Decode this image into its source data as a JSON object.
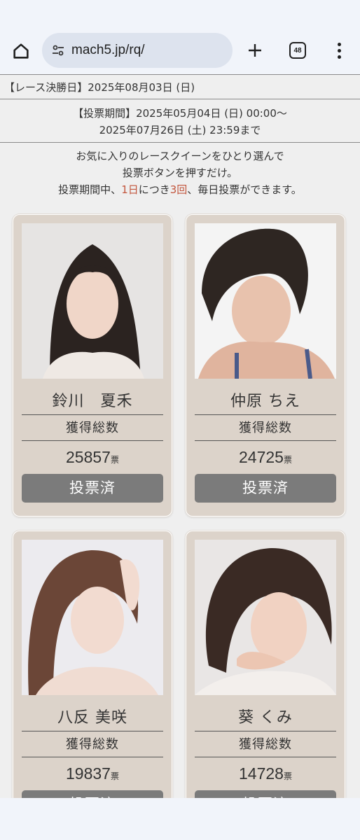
{
  "browser": {
    "url": "mach5.jp/rq/",
    "tab_count": "48"
  },
  "race_date": "【レース決勝日】2025年08月03日 (日)",
  "vote_period": {
    "line1": "【投票期間】2025年05月04日 (日) 00:00～",
    "line2": "2025年07月26日 (土) 23:59まで"
  },
  "intro": {
    "line1": "お気に入りのレースクイーンをひとり選んで",
    "line2": "投票ボタンを押すだけ。",
    "line3_pre": "投票期間中、",
    "line3_hl1": "1日",
    "line3_mid": "につき",
    "line3_hl2": "3回",
    "line3_post": "、毎日投票ができます。"
  },
  "votes_label": "獲得総数",
  "vote_unit": "票",
  "candidates": [
    {
      "name": "鈴川　夏禾",
      "votes": "25857",
      "button": "投票済"
    },
    {
      "name": "仲原 ちえ",
      "votes": "24725",
      "button": "投票済"
    },
    {
      "name": "八反 美咲",
      "votes": "19837",
      "button": "投票済"
    },
    {
      "name": "葵 くみ",
      "votes": "14728",
      "button": "投票済"
    }
  ],
  "colors": {
    "card_bg": "#dcd3ca",
    "button_bg": "#7b7b7b",
    "highlight": "#c2553c"
  }
}
